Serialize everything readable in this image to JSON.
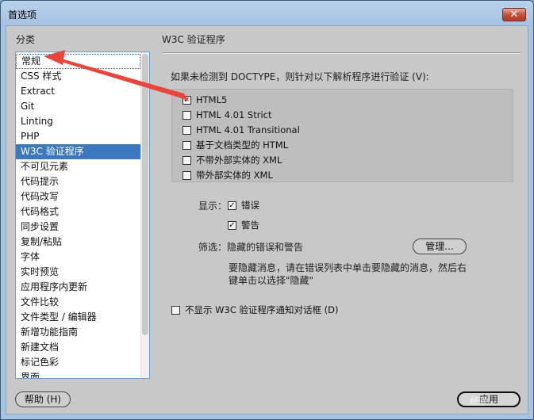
{
  "window": {
    "title": "首选项",
    "close_symbol": "✕"
  },
  "sidebar": {
    "header": "分类",
    "items": [
      {
        "label": "常规"
      },
      {
        "label": "CSS 样式"
      },
      {
        "label": "Extract"
      },
      {
        "label": "Git"
      },
      {
        "label": "Linting"
      },
      {
        "label": "PHP"
      },
      {
        "label": "W3C 验证程序"
      },
      {
        "label": "不可见元素"
      },
      {
        "label": "代码提示"
      },
      {
        "label": "代码改写"
      },
      {
        "label": "代码格式"
      },
      {
        "label": "同步设置"
      },
      {
        "label": "复制/粘贴"
      },
      {
        "label": "字体"
      },
      {
        "label": "实时预览"
      },
      {
        "label": "应用程序内更新"
      },
      {
        "label": "文件比较"
      },
      {
        "label": "文件类型 / 编辑器"
      },
      {
        "label": "新增功能指南"
      },
      {
        "label": "新建文档"
      },
      {
        "label": "标记色彩"
      },
      {
        "label": "界面"
      }
    ],
    "selected_index": 6,
    "focused_index": 0
  },
  "main": {
    "section_title": "W3C 验证程序",
    "doctype_prompt": "如果未检测到 DOCTYPE，则针对以下解析程序进行验证 (V):",
    "doctype_options": [
      {
        "label": "HTML5",
        "checked": true
      },
      {
        "label": "HTML 4.01 Strict",
        "checked": false
      },
      {
        "label": "HTML 4.01 Transitional",
        "checked": false
      },
      {
        "label": "基于文档类型的 HTML",
        "checked": false
      },
      {
        "label": "不带外部实体的 XML",
        "checked": false
      },
      {
        "label": "带外部实体的 XML",
        "checked": false
      }
    ],
    "display_label": "显示：",
    "display_options": [
      {
        "label": "错误",
        "checked": true
      },
      {
        "label": "警告",
        "checked": true
      }
    ],
    "filter_label": "筛选：",
    "filter_value": "隐藏的错误和警告",
    "manage_button": "管理...",
    "hint_text": "要隐藏消息，请在错误列表中单击要隐藏的消息，然后右键单击以选择\"隐藏\"",
    "no_dialog_label": "不显示  W3C 验证程序通知对话框 (D)",
    "no_dialog_checked": false
  },
  "footer": {
    "help_button": "帮助 (H)",
    "apply_button": "应用"
  },
  "watermark_text": "经验",
  "colors": {
    "selection": "#3c78be",
    "annotation_arrow": "#e8453c"
  }
}
